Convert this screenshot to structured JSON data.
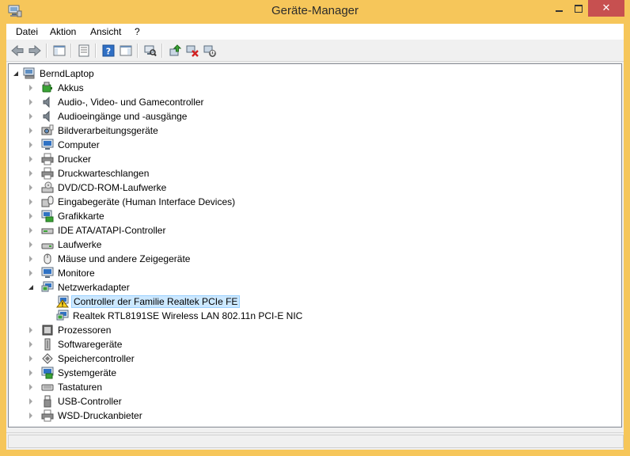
{
  "window": {
    "title": "Geräte-Manager"
  },
  "menu": [
    {
      "label": "Datei"
    },
    {
      "label": "Aktion"
    },
    {
      "label": "Ansicht"
    },
    {
      "label": "?"
    }
  ],
  "toolbar": [
    "back-icon",
    "forward-icon",
    "console-tree-icon",
    "properties-icon",
    "help-icon",
    "action-pane-icon",
    "scan-hardware-icon",
    "update-driver-icon",
    "uninstall-device-icon",
    "enable-device-icon"
  ],
  "tree": {
    "root": "BerndLaptop",
    "categories": [
      {
        "label": "Akkus",
        "icon": "battery-icon"
      },
      {
        "label": "Audio-, Video- und Gamecontroller",
        "icon": "speaker-icon"
      },
      {
        "label": "Audioeingänge und -ausgänge",
        "icon": "speaker-icon"
      },
      {
        "label": "Bildverarbeitungsgeräte",
        "icon": "camera-icon"
      },
      {
        "label": "Computer",
        "icon": "computer-icon"
      },
      {
        "label": "Drucker",
        "icon": "printer-icon"
      },
      {
        "label": "Druckwarteschlangen",
        "icon": "printer-icon"
      },
      {
        "label": "DVD/CD-ROM-Laufwerke",
        "icon": "optical-drive-icon"
      },
      {
        "label": "Eingabegeräte (Human Interface Devices)",
        "icon": "hid-icon"
      },
      {
        "label": "Grafikkarte",
        "icon": "display-adapter-icon"
      },
      {
        "label": "IDE ATA/ATAPI-Controller",
        "icon": "ide-controller-icon"
      },
      {
        "label": "Laufwerke",
        "icon": "disk-drive-icon"
      },
      {
        "label": "Mäuse und andere Zeigegeräte",
        "icon": "mouse-icon"
      },
      {
        "label": "Monitore",
        "icon": "monitor-icon"
      },
      {
        "label": "Netzwerkadapter",
        "icon": "network-adapter-icon",
        "expanded": true,
        "children": [
          {
            "label": "Controller der Familie Realtek PCIe FE",
            "icon": "network-adapter-warning-icon",
            "selected": true
          },
          {
            "label": "Realtek RTL8191SE Wireless LAN 802.11n PCI-E NIC",
            "icon": "network-adapter-icon"
          }
        ]
      },
      {
        "label": "Prozessoren",
        "icon": "processor-icon"
      },
      {
        "label": "Softwaregeräte",
        "icon": "software-device-icon"
      },
      {
        "label": "Speichercontroller",
        "icon": "storage-controller-icon"
      },
      {
        "label": "Systemgeräte",
        "icon": "system-device-icon"
      },
      {
        "label": "Tastaturen",
        "icon": "keyboard-icon"
      },
      {
        "label": "USB-Controller",
        "icon": "usb-icon"
      },
      {
        "label": "WSD-Druckanbieter",
        "icon": "printer-icon"
      }
    ]
  }
}
